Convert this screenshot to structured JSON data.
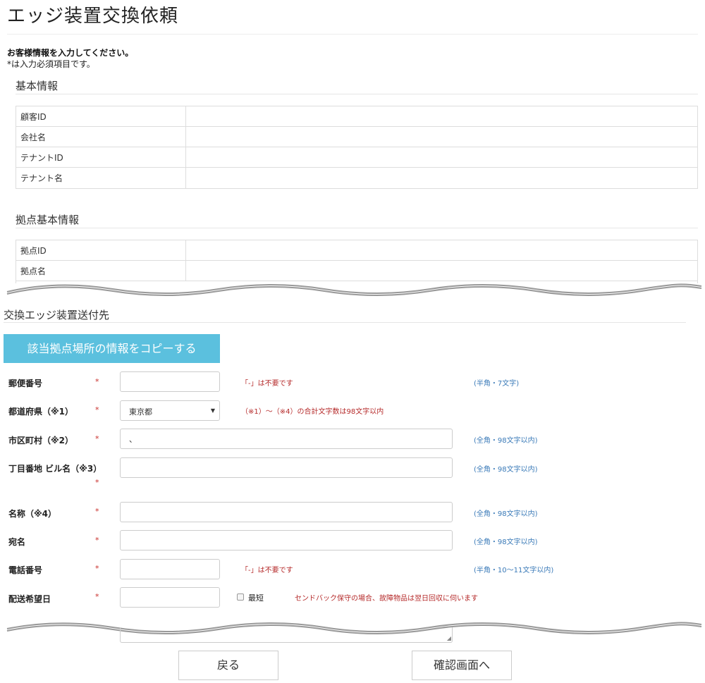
{
  "page": {
    "title": "エッジ装置交換依頼",
    "intro_heading": "お客様情報を入力してください。",
    "intro_note": "*は入力必須項目です。"
  },
  "basic_info": {
    "title": "基本情報",
    "rows": [
      {
        "label": "顧客ID",
        "value": ""
      },
      {
        "label": "会社名",
        "value": ""
      },
      {
        "label": "テナントID",
        "value": ""
      },
      {
        "label": "テナント名",
        "value": ""
      }
    ]
  },
  "site_info": {
    "title": "拠点基本情報",
    "rows": [
      {
        "label": "拠点ID",
        "value": ""
      },
      {
        "label": "拠点名",
        "value": ""
      }
    ]
  },
  "shipping": {
    "title": "交換エッジ装置送付先",
    "copy_button": "該当拠点場所の情報をコピーする",
    "required_mark": "*",
    "fields": {
      "postal": {
        "label": "郵便番号",
        "value": "",
        "note_red": "「-」は不要です",
        "note_blue": "(半角・7文字)"
      },
      "prefecture": {
        "label": "都道府県（※1）",
        "value": "東京都",
        "note_red": "（※1）～（※4）の合計文字数は98文字以内"
      },
      "city": {
        "label": "市区町村（※2）",
        "value": "、",
        "note_blue": "(全角・98文字以内)"
      },
      "street": {
        "label": "丁目番地 ビル名（※3）",
        "value": "",
        "note_blue": "(全角・98文字以内)"
      },
      "name": {
        "label": "名称（※4）",
        "value": "",
        "note_blue": "(全角・98文字以内)"
      },
      "recipient": {
        "label": "宛名",
        "value": "",
        "note_blue": "(全角・98文字以内)"
      },
      "phone": {
        "label": "電話番号",
        "value": "",
        "note_red": "「-」は不要です",
        "note_blue": "(半角・10～11文字以内)"
      },
      "delivery_date": {
        "label": "配送希望日",
        "value": "",
        "checkbox_label": "最短",
        "note_red": "センドバック保守の場合、故障物品は翌日回収に伺います"
      }
    }
  },
  "actions": {
    "back": "戻る",
    "confirm": "確認画面へ"
  },
  "colors": {
    "copy_button_bg": "#5bc0de",
    "required": "#c9302c",
    "note_red": "#b52a2a",
    "note_blue": "#3a7ab8"
  }
}
